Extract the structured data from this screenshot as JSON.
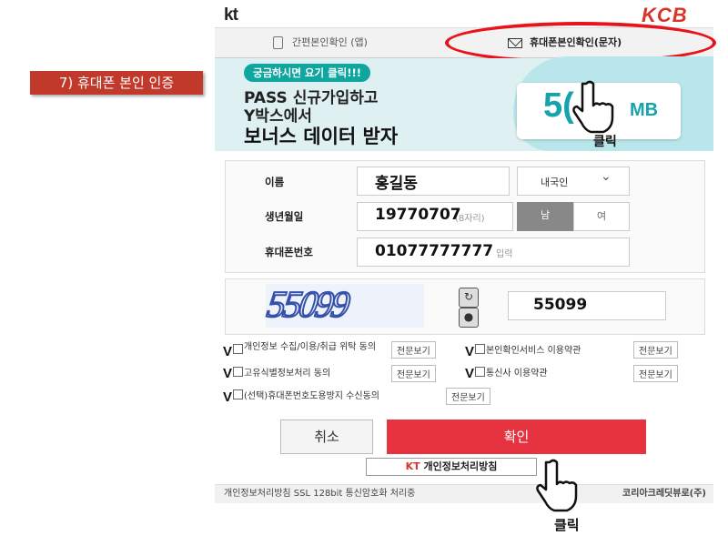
{
  "step_label": "7) 휴대폰 본인 인증",
  "header": {
    "left_logo": "kt",
    "right_logo": "KCB"
  },
  "tabs": {
    "app": "간편본인확인 (앱)",
    "sms": "휴대폰본인확인(문자)"
  },
  "banner": {
    "pill": "궁금하시면 요기 클릭!!!",
    "line1": "PASS 신규가입하고",
    "line2": "Y박스에서",
    "line3": "보너스 데이터 받자",
    "amount": "5(",
    "unit": "MB",
    "annotation": "클릭"
  },
  "form": {
    "name_label": "이름",
    "name_value": "홍길동",
    "nationality": "내국인",
    "birth_label": "생년월일",
    "birth_value": "19770707",
    "birth_placeholder": "(8자리)",
    "gender_male": "남",
    "gender_female": "여",
    "phone_label": "휴대폰번호",
    "phone_value": "01077777777",
    "phone_placeholder": "입력"
  },
  "captcha": {
    "image_text": "55099",
    "input_value": "55099"
  },
  "agreements": {
    "check_mark": "V",
    "items": [
      {
        "label": "개인정보 수집/이용/취급 위탁 동의",
        "view": "전문보기"
      },
      {
        "label": "본인확인서비스 이용약관",
        "view": "전문보기"
      },
      {
        "label": "고유식별정보처리 동의",
        "view": "전문보기"
      },
      {
        "label": "통신사 이용약관",
        "view": "전문보기"
      },
      {
        "label": "(선택)휴대폰번호도용방지 수신동의",
        "view": "전문보기"
      }
    ]
  },
  "buttons": {
    "cancel": "취소",
    "confirm": "확인",
    "policy_prefix": "KT",
    "policy": "개인정보처리방침"
  },
  "footer": {
    "left": "개인정보처리방침   SSL 128bit 통신암호화 처리중",
    "right": "코리아크레딧뷰로(주)"
  },
  "bottom_annotation": "클릭",
  "colors": {
    "accent_red": "#e5343f",
    "oval_red": "#e8141b",
    "banner_teal": "#10a6a0"
  }
}
